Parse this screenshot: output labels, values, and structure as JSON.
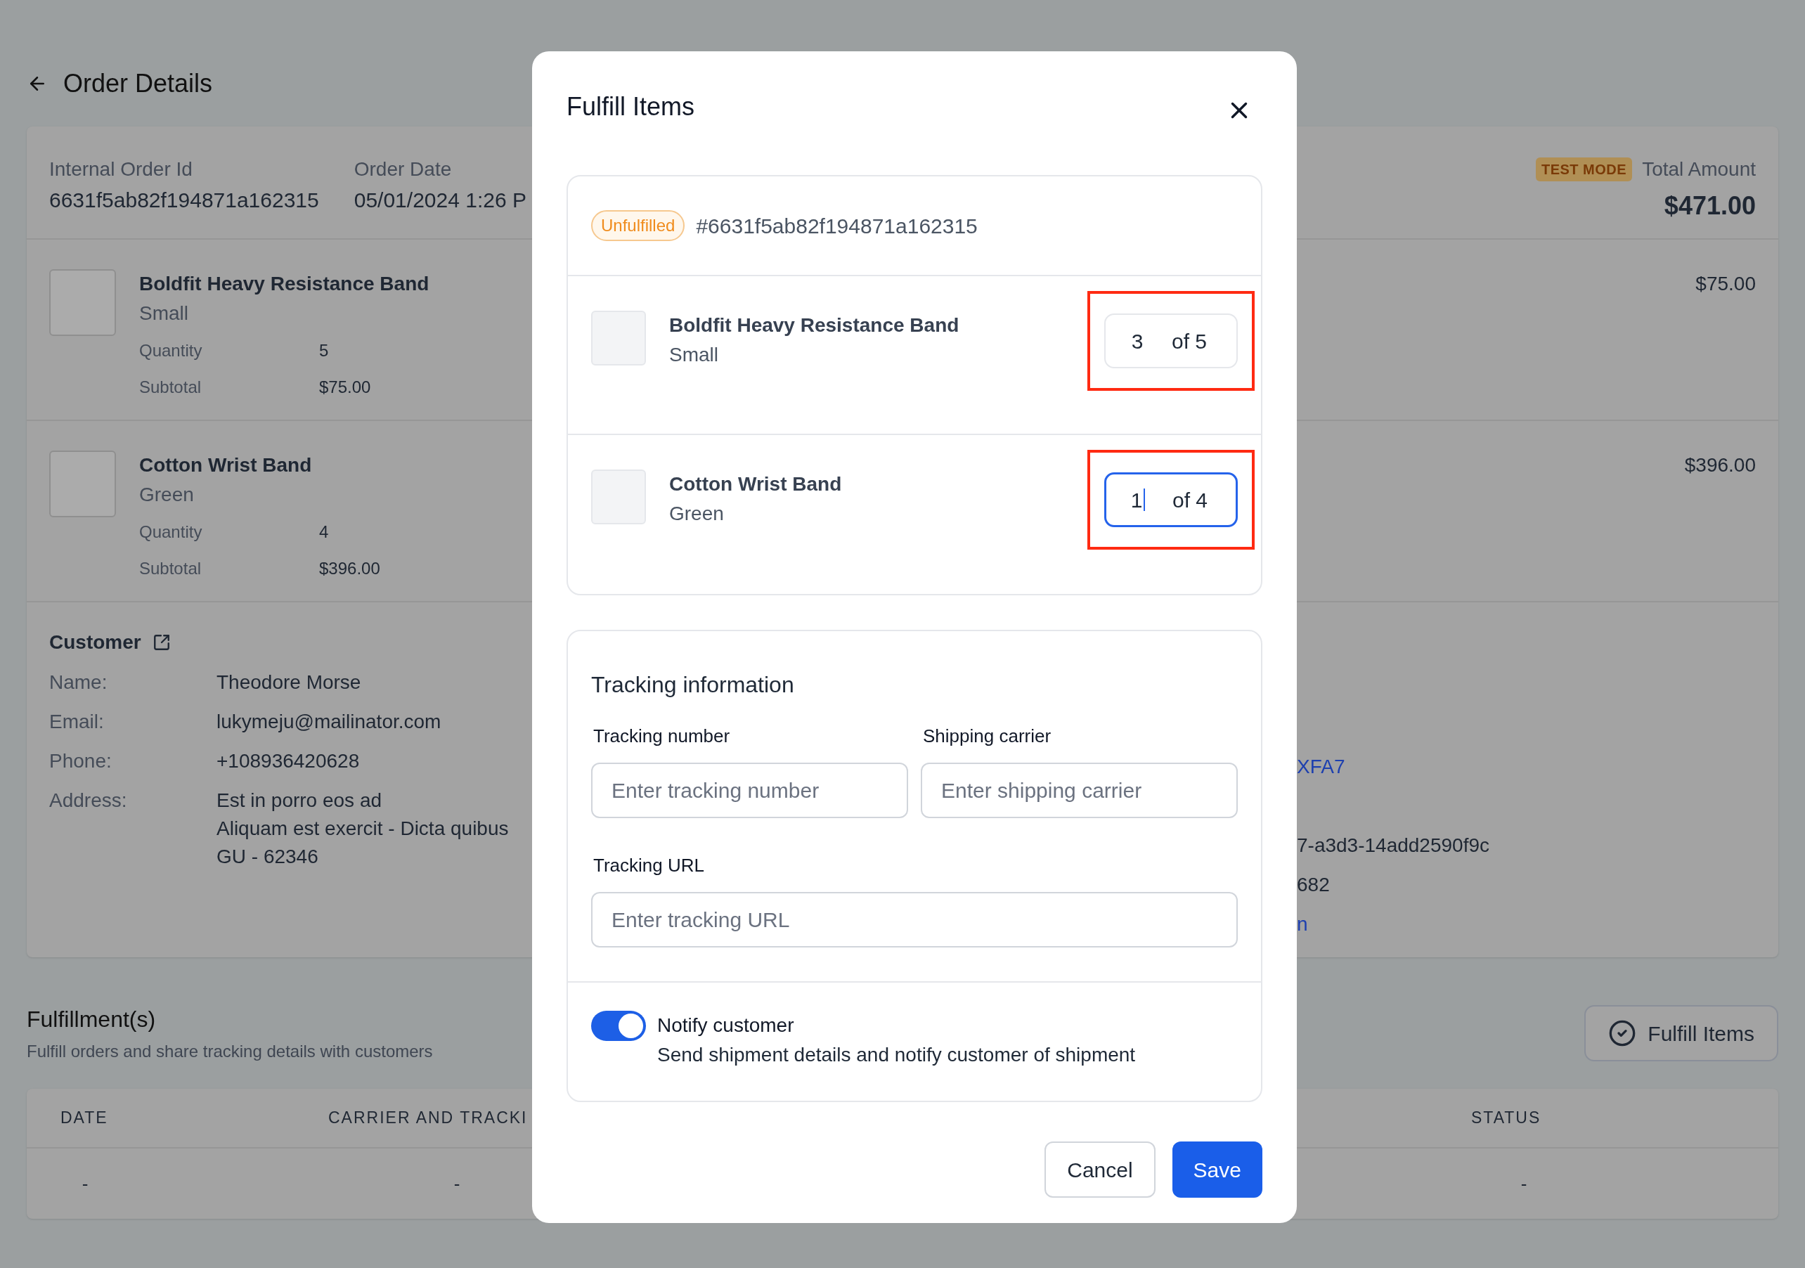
{
  "page": {
    "title": "Order Details"
  },
  "order": {
    "fields": [
      {
        "label": "Internal Order Id",
        "value": "6631f5ab82f194871a162315"
      },
      {
        "label": "Order Date",
        "value": "05/01/2024 1:26 P"
      }
    ],
    "badge": "TEST MODE",
    "total_label": "Total Amount",
    "total": "$471.00"
  },
  "items": [
    {
      "name": "Boldfit Heavy Resistance Band",
      "variant": "Small",
      "details": [
        {
          "label": "Quantity",
          "value": "5"
        },
        {
          "label": "Subtotal",
          "value": "$75.00"
        }
      ],
      "price": "$75.00"
    },
    {
      "name": "Cotton Wrist Band",
      "variant": "Green",
      "details": [
        {
          "label": "Quantity",
          "value": "4"
        },
        {
          "label": "Subtotal",
          "value": "$396.00"
        }
      ],
      "price": "$396.00"
    }
  ],
  "customer": {
    "title": "Customer",
    "rows": [
      {
        "label": "Name:",
        "lines": [
          "Theodore Morse"
        ]
      },
      {
        "label": "Email:",
        "lines": [
          "lukymeju@mailinator.com"
        ]
      },
      {
        "label": "Phone:",
        "lines": [
          "+108936420628"
        ]
      },
      {
        "label": "Address:",
        "lines": [
          "Est in porro eos ad",
          "Aliquam est exercit - Dicta quibus",
          "GU - 62346"
        ]
      }
    ]
  },
  "side_details": [
    {
      "text": "XFA7",
      "kind": "link"
    },
    {
      "text": "7-a3d3-14add2590f9c",
      "kind": "text"
    },
    {
      "text": "682",
      "kind": "text"
    },
    {
      "text": "n",
      "kind": "link"
    }
  ],
  "fulfillments": {
    "title": "Fulfillment(s)",
    "subtitle": "Fulfill orders and share tracking details with customers",
    "button": "Fulfill Items",
    "columns": [
      "DATE",
      "CARRIER AND TRACKI",
      "STATUS"
    ],
    "rows": [
      [
        "-",
        "-",
        "-"
      ]
    ]
  },
  "modal": {
    "title": "Fulfill Items",
    "order": {
      "status": "Unfulfilled",
      "number": "#6631f5ab82f194871a162315"
    },
    "items": [
      {
        "name": "Boldfit Heavy Resistance Band",
        "variant": "Small",
        "quantity": "3",
        "of": "of 5",
        "focused": false,
        "highlighted": true
      },
      {
        "name": "Cotton Wrist Band",
        "variant": "Green",
        "quantity": "1",
        "of": "of 4",
        "focused": true,
        "highlighted": true
      }
    ],
    "tracking": {
      "title": "Tracking information",
      "fields": [
        {
          "label": "Tracking number",
          "placeholder": "Enter tracking number"
        },
        {
          "label": "Shipping carrier",
          "placeholder": "Enter shipping carrier"
        },
        {
          "label": "Tracking URL",
          "placeholder": "Enter tracking URL"
        }
      ]
    },
    "notify": {
      "label": "Notify customer",
      "description": "Send shipment details and notify customer of shipment",
      "on": true
    },
    "buttons": [
      {
        "label": "Cancel",
        "kind": "secondary"
      },
      {
        "label": "Save",
        "kind": "primary"
      }
    ]
  }
}
